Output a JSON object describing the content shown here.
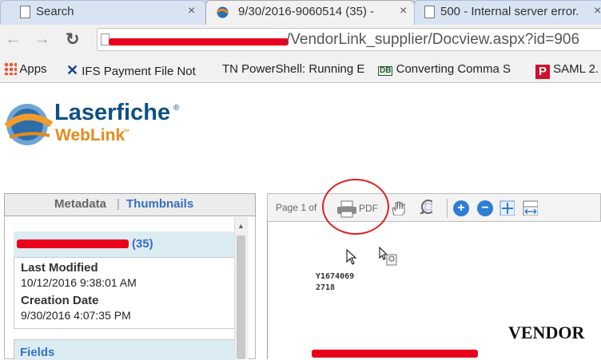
{
  "tabs": [
    {
      "title": "Search",
      "active": false
    },
    {
      "title": "9/30/2016-9060514 (35) -",
      "active": true
    },
    {
      "title": "500 - Internal server error.",
      "active": false
    }
  ],
  "address": {
    "url": "/VendorLink_supplier/Docview.aspx?id=906"
  },
  "bookmarks": [
    {
      "label": "Apps",
      "icon": "apps-grid-icon"
    },
    {
      "label": "IFS Payment File Not",
      "icon": "x-logo-icon"
    },
    {
      "label": "TN PowerShell: Running E",
      "icon": "tn-icon"
    },
    {
      "label": "Converting Comma S",
      "icon": "db-icon"
    },
    {
      "label": "SAML 2.",
      "icon": "p-logo-icon"
    }
  ],
  "logo": {
    "line1": "Laserfiche",
    "line2": "WebLink",
    "reg": "®",
    "tm": "™"
  },
  "left_panel": {
    "metadata_label": "Metadata",
    "separator": "|",
    "thumbnails_label": "Thumbnails",
    "doc_title_suffix": "(35)",
    "last_modified_label": "Last Modified",
    "last_modified_value": "10/12/2016 9:38:01 AM",
    "creation_date_label": "Creation Date",
    "creation_date_value": "9/30/2016 4:07:35 PM",
    "fields_label": "Fields"
  },
  "viewer": {
    "page_label": "Page 1 of",
    "pdf_label": "PDF",
    "doc_line1": "Y1674069",
    "doc_line2": "2718",
    "doc_heading": "VENDOR"
  },
  "colors": {
    "accent_link": "#3a6fc4",
    "redaction": "#e8001c",
    "annotation_circle": "#d22222"
  }
}
